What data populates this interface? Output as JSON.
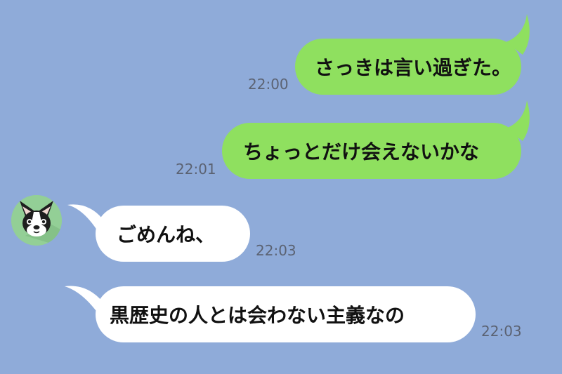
{
  "colors": {
    "background": "#8fabd9",
    "outgoing_bubble": "#8fe05f",
    "incoming_bubble": "#ffffff",
    "timestamp": "#5b6272",
    "avatar_background": "#93cf96"
  },
  "contact": {
    "avatar_icon": "french-bulldog-icon"
  },
  "messages": [
    {
      "direction": "outgoing",
      "text": "さっきは言い過ぎた。",
      "time": "22:00"
    },
    {
      "direction": "outgoing",
      "text": "ちょっとだけ会えないかな",
      "time": "22:01"
    },
    {
      "direction": "incoming",
      "text": "ごめんね、",
      "time": "22:03"
    },
    {
      "direction": "incoming",
      "text": "黒歴史の人とは会わない主義なの",
      "time": "22:03"
    }
  ]
}
